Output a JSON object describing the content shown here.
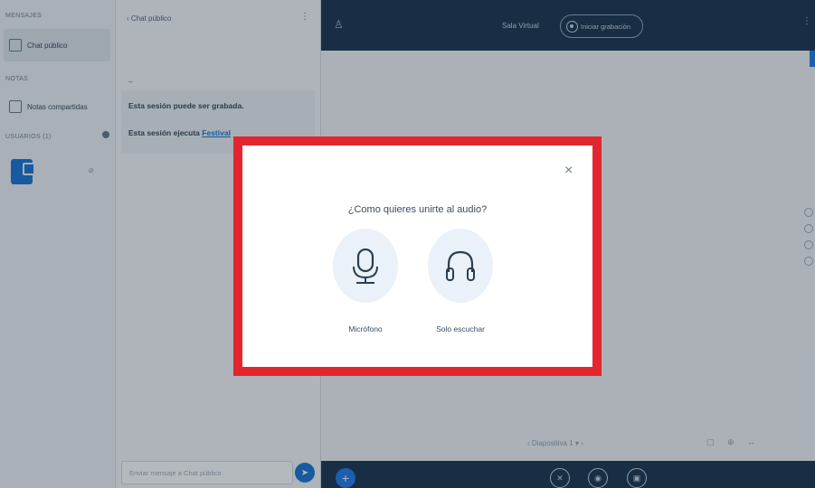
{
  "sidebar": {
    "heading_messages": "MENSAJES",
    "public_chat_label": "Chat público",
    "heading_notes": "NOTAS",
    "shared_notes_label": "Notas compartidas",
    "heading_users": "USUARIOS (1)"
  },
  "chat": {
    "header_label": "‹  Chat público",
    "kebab": "⋮",
    "dash": "–",
    "msg_recorded": "Esta sesión puede ser grabada.",
    "msg_shortcuts_prefix": "Esta sesión ejecuta",
    "msg_shortcuts_link": "Festival",
    "input_placeholder": "Enviar mensaje a Chat público",
    "send_icon": "➤"
  },
  "topbar": {
    "user_icon": "♙",
    "room_name": "Sala Virtual",
    "record_label": "Iniciar grabación",
    "kebab": "⋮"
  },
  "presentation": {
    "slide_nav": "‹   Diapositiva 1  ▾   ›",
    "tools": "▢ ⊕ ↔"
  },
  "bottombar": {
    "plus": "+",
    "mic": "✕",
    "cam": "◉",
    "share": "▣"
  },
  "modal": {
    "close": "×",
    "title": "¿Como quieres unirte al audio?",
    "option_microphone": "Micrófono",
    "option_listen": "Solo escuchar"
  }
}
